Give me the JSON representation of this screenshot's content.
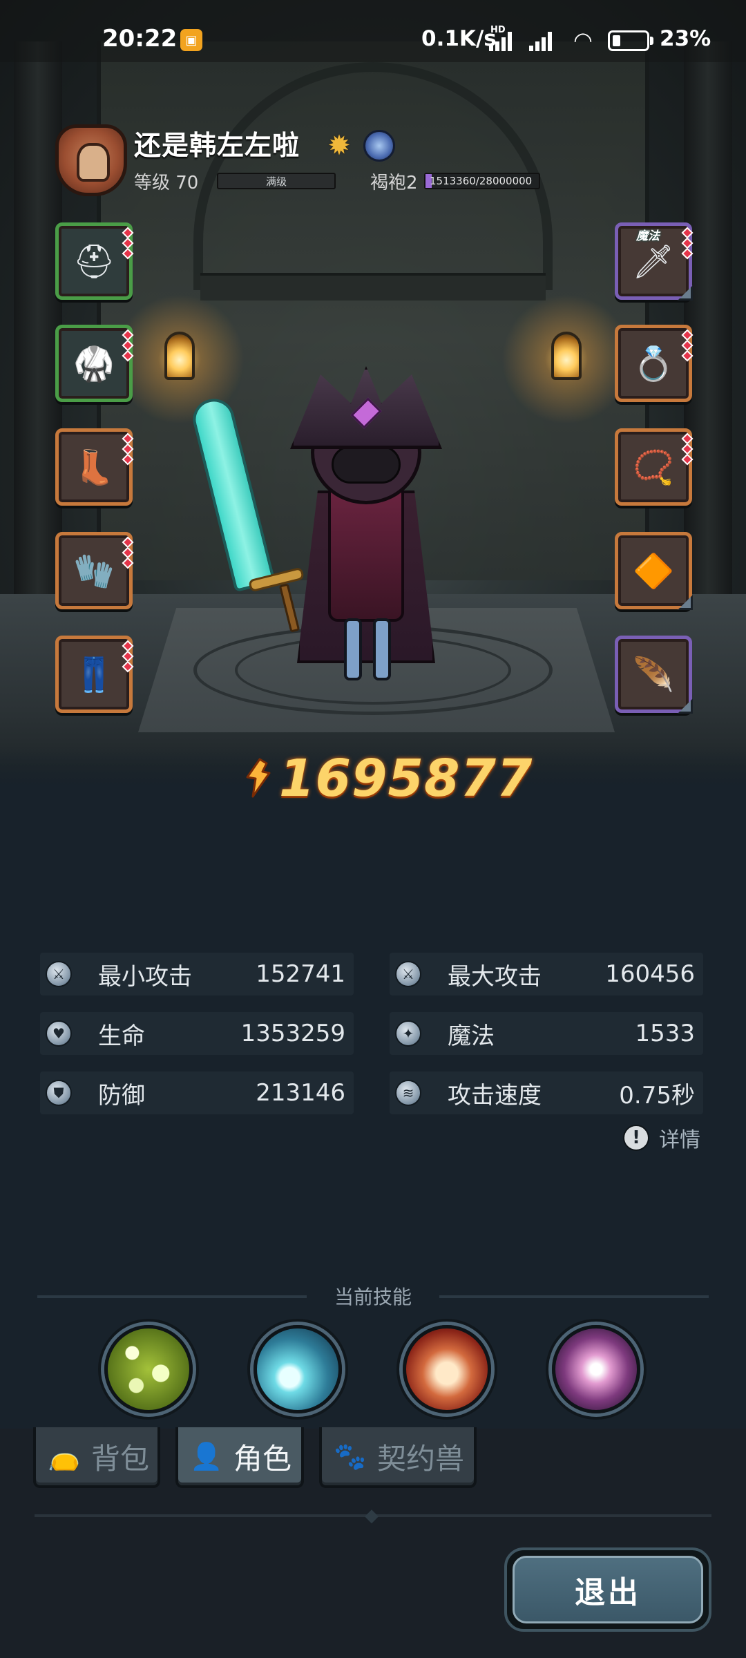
{
  "status_bar": {
    "time": "20:22",
    "network_speed": "0.1K/s",
    "network_badge": "HD",
    "battery_percent": "23%",
    "battery_level": 0.23,
    "icons": [
      "app-notification-icon",
      "signal-icon",
      "signal-icon",
      "wifi-icon",
      "battery-icon"
    ]
  },
  "player": {
    "name": "还是韩左左啦",
    "level_label": "等级 70",
    "level_status": "满级",
    "rank_label": "褐袍2",
    "exp_text": "1513360/28000000",
    "exp_progress": 0.054,
    "badges": [
      "rank-shield-icon",
      "sun-title-icon",
      "moon-title-icon"
    ]
  },
  "equipment": {
    "left": [
      {
        "name": "helmet",
        "icon": "helmet-icon",
        "glyph": "⛑",
        "rarity": "green",
        "gems": 3
      },
      {
        "name": "armor",
        "icon": "chest-armor-icon",
        "glyph": "🥋",
        "rarity": "green",
        "gems": 3
      },
      {
        "name": "boots",
        "icon": "boots-icon",
        "glyph": "👢",
        "rarity": "orange",
        "gems": 3
      },
      {
        "name": "gloves",
        "icon": "gloves-icon",
        "glyph": "🧤",
        "rarity": "orange",
        "gems": 3
      },
      {
        "name": "pants",
        "icon": "pants-icon",
        "glyph": "👖",
        "rarity": "orange",
        "gems": 3
      }
    ],
    "right": [
      {
        "name": "weapon",
        "icon": "sword-icon",
        "glyph": "🗡",
        "rarity": "purple",
        "gems": 3,
        "tag": "魔法"
      },
      {
        "name": "ring",
        "icon": "ring-icon",
        "glyph": "💍",
        "rarity": "orange",
        "gems": 3
      },
      {
        "name": "necklace",
        "icon": "necklace-icon",
        "glyph": "📿",
        "rarity": "orange",
        "gems": 3
      },
      {
        "name": "charm",
        "icon": "amulet-icon",
        "glyph": "🔶",
        "rarity": "orange",
        "gems": 0
      },
      {
        "name": "wings",
        "icon": "wing-icon",
        "glyph": "🪶",
        "rarity": "purple",
        "gems": 0
      }
    ]
  },
  "power": {
    "icon": "combat-power-icon",
    "value": "1695877"
  },
  "stats": [
    {
      "icon": "sword-stat-icon",
      "glyph": "⚔",
      "label": "最小攻击",
      "value": "152741"
    },
    {
      "icon": "sword-stat-icon",
      "glyph": "⚔",
      "label": "最大攻击",
      "value": "160456"
    },
    {
      "icon": "heart-icon",
      "glyph": "♥",
      "label": "生命",
      "value": "1353259"
    },
    {
      "icon": "magic-swirl-icon",
      "glyph": "✦",
      "label": "魔法",
      "value": "1533"
    },
    {
      "icon": "shield-icon",
      "glyph": "⛊",
      "label": "防御",
      "value": "213146"
    },
    {
      "icon": "speed-icon",
      "glyph": "≋",
      "label": "攻击速度",
      "value": "0.75秒"
    }
  ],
  "details_label": "详情",
  "skills": {
    "title": "当前技能",
    "items": [
      "poison-bubbles-skill-icon",
      "frost-nova-skill-icon",
      "fire-strike-skill-icon",
      "shadow-burst-skill-icon"
    ]
  },
  "tabs": [
    {
      "label": "背包",
      "icon": "bag-icon",
      "glyph": "👝",
      "active": false
    },
    {
      "label": "角色",
      "icon": "character-icon",
      "glyph": "👤",
      "active": true
    },
    {
      "label": "契约兽",
      "icon": "paw-icon",
      "glyph": "🐾",
      "active": false
    }
  ],
  "exit_label": "退出",
  "colors": {
    "background": "#18222b",
    "power_text": "#fcd46a",
    "exp_fill": "#9a6ad6",
    "slot_orange": "#c7793c",
    "slot_green": "#4a9d47",
    "slot_purple": "#7a5fb5",
    "gem": "#e5344a"
  }
}
